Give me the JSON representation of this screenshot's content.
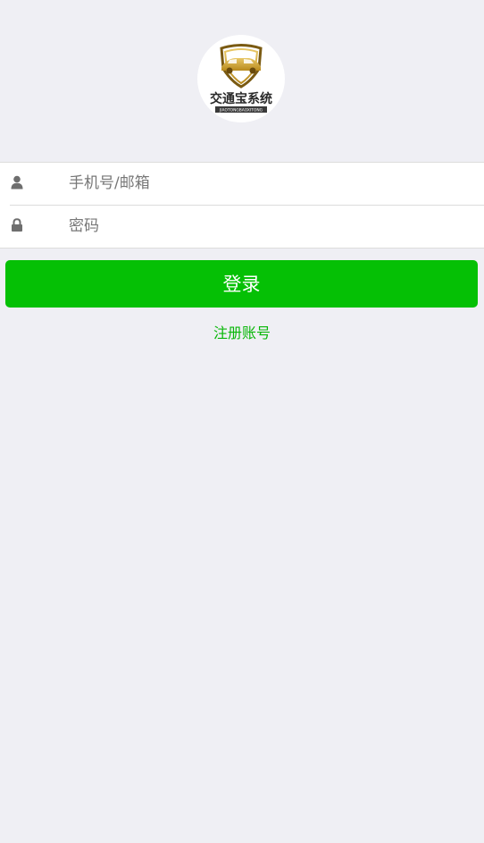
{
  "logo": {
    "brand_text": "交通宝系统",
    "sub_text": "JIAOTONGBAOXITONG"
  },
  "form": {
    "account_placeholder": "手机号/邮箱",
    "password_placeholder": "密码",
    "account_value": "",
    "password_value": ""
  },
  "actions": {
    "login_label": "登录",
    "register_label": "注册账号"
  },
  "icons": {
    "account": "user-icon",
    "password": "lock-icon"
  },
  "colors": {
    "background": "#efeff4",
    "primary": "#05c005",
    "link": "#08b708",
    "icon": "#6e6e6e"
  }
}
